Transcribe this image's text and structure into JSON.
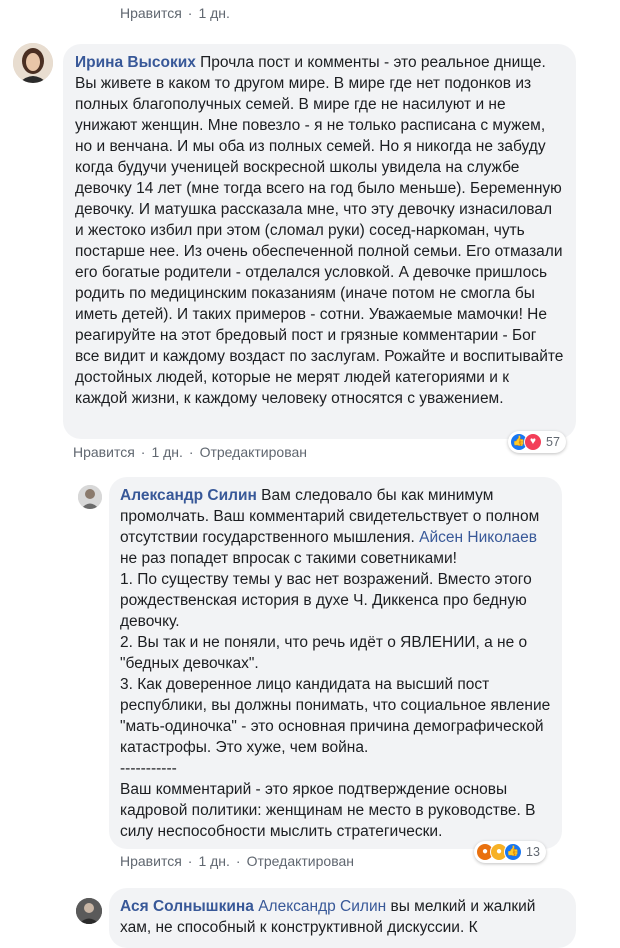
{
  "top_actions": {
    "like": "Нравится",
    "time": "1 дн."
  },
  "comment1": {
    "author": "Ирина Высоких",
    "text": " Прочла пост и комменты - это реальное днище. Вы живете в каком то другом мире. В мире где нет подонков из полных благополучных семей. В мире где не насилуют и не унижают женщин. Мне повезло - я не только расписана с мужем, но и венчана. И мы оба из полных семей. Но я никогда не забуду когда будучи ученицей воскресной школы увидела на службе девочку 14 лет (мне тогда всего на год было меньше). Беременную девочку. И матушка рассказала мне, что эту девочку изнасиловал и жестоко избил при этом (сломал руки) сосед-наркоман, чуть постарше нее. Из очень обеспеченной полной семьи. Его отмазали его богатые родители - отделался условкой. А девочке пришлось родить по медицинским показаниям (иначе потом не смогла бы иметь детей). И таких примеров - сотни. Уважаемые мамочки! Не реагируйте на этот бредовый пост и грязные комментарии - Бог все видит и каждому воздаст по заслугам. Рожайте и воспитывайте достойных людей, которые не мерят людей категориями и к каждой жизни, к каждому человеку относятся с уважением.",
    "actions": {
      "like": "Нравится",
      "time": "1 дн.",
      "edited": "Отредактирован"
    },
    "reactions": {
      "count": "57",
      "icons": [
        "like-reaction-icon",
        "love-reaction-icon"
      ],
      "colors": [
        "#1877f2",
        "#f33e58"
      ]
    }
  },
  "comment2": {
    "author": "Александр Силин",
    "text_part1": " Вам следовало бы как минимум промолчать. Ваш комментарий свидетельствует о полном отсутствии государственного мышления. ",
    "mention": "Айсен Николаев",
    "text_part2": " не раз попадет впросак с такими советниками!\n1. По существу темы у вас нет возражений. Вместо этого рождественская история в духе Ч. Диккенса про бедную девочку.\n2. Вы так и не поняли, что речь идёт о ЯВЛЕНИИ, а не о \"бедных девочках\".\n3. Как доверенное лицо кандидата на высший пост республики, вы должны понимать, что социальное явление \"мать-одиночка\" - это основная причина демографической катастрофы. Это хуже, чем война.\n-----------\nВаш комментарий - это яркое подтверждение основы кадровой политики: женщинам не место в руководстве. В силу неспособности мыслить стратегически.",
    "actions": {
      "like": "Нравится",
      "time": "1 дн.",
      "edited": "Отредактирован"
    },
    "reactions": {
      "count": "13",
      "icons": [
        "angry-reaction-icon",
        "haha-reaction-icon",
        "like-reaction-icon"
      ],
      "colors": [
        "#e9710f",
        "#f7b125",
        "#1877f2"
      ]
    }
  },
  "comment3": {
    "author": "Ася Солнышкина",
    "mention": "Александр Силин",
    "text": " вы мелкий и жалкий хам, не способный к конструктивной дискуссии. К"
  }
}
